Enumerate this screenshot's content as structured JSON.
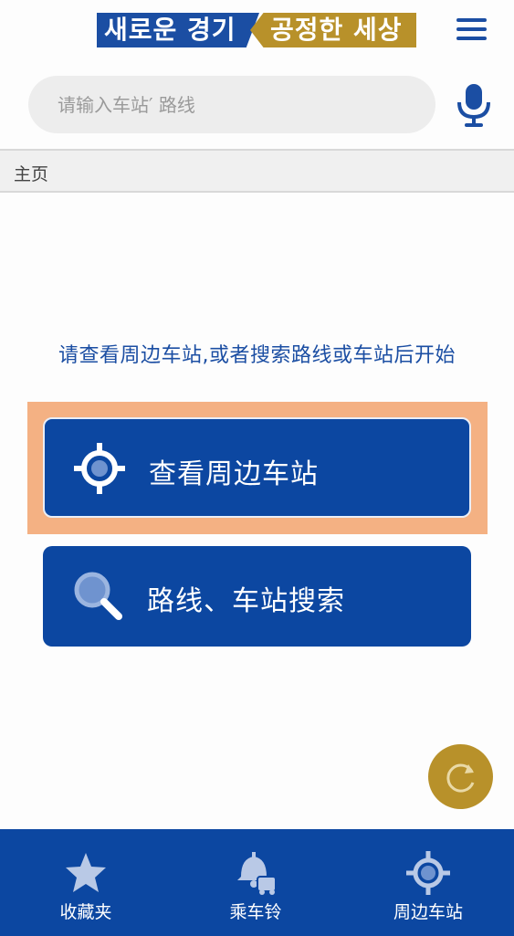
{
  "header": {
    "logo_left": "새로운 경기",
    "logo_right": "공정한 세상",
    "menu_icon": "hamburger-menu-icon"
  },
  "search": {
    "placeholder": "请输入车站′ 路线",
    "value": "",
    "mic_icon": "microphone-icon"
  },
  "breadcrumb": {
    "label": "主页"
  },
  "main": {
    "prompt": "请查看周边车站,或者搜索路线或车站后开始",
    "buttons": [
      {
        "label": "查看周边车站",
        "icon": "location-target-icon"
      },
      {
        "label": "路线、车站搜索",
        "icon": "search-icon"
      }
    ],
    "refresh_icon": "refresh-icon"
  },
  "bottom_nav": {
    "items": [
      {
        "label": "收藏夹",
        "icon": "star-icon"
      },
      {
        "label": "乘车铃",
        "icon": "bus-bell-icon"
      },
      {
        "label": "周边车站",
        "icon": "location-target-icon"
      }
    ]
  },
  "colors": {
    "primary_blue": "#0c47a1",
    "brand_blue": "#1b4ea3",
    "brand_gold": "#b8912a",
    "highlight": "#f4b183"
  }
}
